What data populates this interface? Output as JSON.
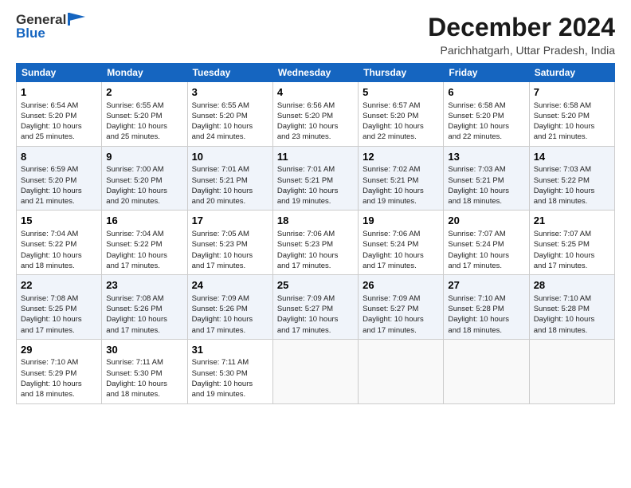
{
  "logo": {
    "general": "General",
    "blue": "Blue"
  },
  "title": "December 2024",
  "location": "Parichhatgarh, Uttar Pradesh, India",
  "weekdays": [
    "Sunday",
    "Monday",
    "Tuesday",
    "Wednesday",
    "Thursday",
    "Friday",
    "Saturday"
  ],
  "weeks": [
    [
      {
        "day": "1",
        "detail": "Sunrise: 6:54 AM\nSunset: 5:20 PM\nDaylight: 10 hours\nand 25 minutes."
      },
      {
        "day": "2",
        "detail": "Sunrise: 6:55 AM\nSunset: 5:20 PM\nDaylight: 10 hours\nand 25 minutes."
      },
      {
        "day": "3",
        "detail": "Sunrise: 6:55 AM\nSunset: 5:20 PM\nDaylight: 10 hours\nand 24 minutes."
      },
      {
        "day": "4",
        "detail": "Sunrise: 6:56 AM\nSunset: 5:20 PM\nDaylight: 10 hours\nand 23 minutes."
      },
      {
        "day": "5",
        "detail": "Sunrise: 6:57 AM\nSunset: 5:20 PM\nDaylight: 10 hours\nand 22 minutes."
      },
      {
        "day": "6",
        "detail": "Sunrise: 6:58 AM\nSunset: 5:20 PM\nDaylight: 10 hours\nand 22 minutes."
      },
      {
        "day": "7",
        "detail": "Sunrise: 6:58 AM\nSunset: 5:20 PM\nDaylight: 10 hours\nand 21 minutes."
      }
    ],
    [
      {
        "day": "8",
        "detail": "Sunrise: 6:59 AM\nSunset: 5:20 PM\nDaylight: 10 hours\nand 21 minutes."
      },
      {
        "day": "9",
        "detail": "Sunrise: 7:00 AM\nSunset: 5:20 PM\nDaylight: 10 hours\nand 20 minutes."
      },
      {
        "day": "10",
        "detail": "Sunrise: 7:01 AM\nSunset: 5:21 PM\nDaylight: 10 hours\nand 20 minutes."
      },
      {
        "day": "11",
        "detail": "Sunrise: 7:01 AM\nSunset: 5:21 PM\nDaylight: 10 hours\nand 19 minutes."
      },
      {
        "day": "12",
        "detail": "Sunrise: 7:02 AM\nSunset: 5:21 PM\nDaylight: 10 hours\nand 19 minutes."
      },
      {
        "day": "13",
        "detail": "Sunrise: 7:03 AM\nSunset: 5:21 PM\nDaylight: 10 hours\nand 18 minutes."
      },
      {
        "day": "14",
        "detail": "Sunrise: 7:03 AM\nSunset: 5:22 PM\nDaylight: 10 hours\nand 18 minutes."
      }
    ],
    [
      {
        "day": "15",
        "detail": "Sunrise: 7:04 AM\nSunset: 5:22 PM\nDaylight: 10 hours\nand 18 minutes."
      },
      {
        "day": "16",
        "detail": "Sunrise: 7:04 AM\nSunset: 5:22 PM\nDaylight: 10 hours\nand 17 minutes."
      },
      {
        "day": "17",
        "detail": "Sunrise: 7:05 AM\nSunset: 5:23 PM\nDaylight: 10 hours\nand 17 minutes."
      },
      {
        "day": "18",
        "detail": "Sunrise: 7:06 AM\nSunset: 5:23 PM\nDaylight: 10 hours\nand 17 minutes."
      },
      {
        "day": "19",
        "detail": "Sunrise: 7:06 AM\nSunset: 5:24 PM\nDaylight: 10 hours\nand 17 minutes."
      },
      {
        "day": "20",
        "detail": "Sunrise: 7:07 AM\nSunset: 5:24 PM\nDaylight: 10 hours\nand 17 minutes."
      },
      {
        "day": "21",
        "detail": "Sunrise: 7:07 AM\nSunset: 5:25 PM\nDaylight: 10 hours\nand 17 minutes."
      }
    ],
    [
      {
        "day": "22",
        "detail": "Sunrise: 7:08 AM\nSunset: 5:25 PM\nDaylight: 10 hours\nand 17 minutes."
      },
      {
        "day": "23",
        "detail": "Sunrise: 7:08 AM\nSunset: 5:26 PM\nDaylight: 10 hours\nand 17 minutes."
      },
      {
        "day": "24",
        "detail": "Sunrise: 7:09 AM\nSunset: 5:26 PM\nDaylight: 10 hours\nand 17 minutes."
      },
      {
        "day": "25",
        "detail": "Sunrise: 7:09 AM\nSunset: 5:27 PM\nDaylight: 10 hours\nand 17 minutes."
      },
      {
        "day": "26",
        "detail": "Sunrise: 7:09 AM\nSunset: 5:27 PM\nDaylight: 10 hours\nand 17 minutes."
      },
      {
        "day": "27",
        "detail": "Sunrise: 7:10 AM\nSunset: 5:28 PM\nDaylight: 10 hours\nand 18 minutes."
      },
      {
        "day": "28",
        "detail": "Sunrise: 7:10 AM\nSunset: 5:28 PM\nDaylight: 10 hours\nand 18 minutes."
      }
    ],
    [
      {
        "day": "29",
        "detail": "Sunrise: 7:10 AM\nSunset: 5:29 PM\nDaylight: 10 hours\nand 18 minutes."
      },
      {
        "day": "30",
        "detail": "Sunrise: 7:11 AM\nSunset: 5:30 PM\nDaylight: 10 hours\nand 18 minutes."
      },
      {
        "day": "31",
        "detail": "Sunrise: 7:11 AM\nSunset: 5:30 PM\nDaylight: 10 hours\nand 19 minutes."
      },
      {
        "day": "",
        "detail": ""
      },
      {
        "day": "",
        "detail": ""
      },
      {
        "day": "",
        "detail": ""
      },
      {
        "day": "",
        "detail": ""
      }
    ]
  ]
}
